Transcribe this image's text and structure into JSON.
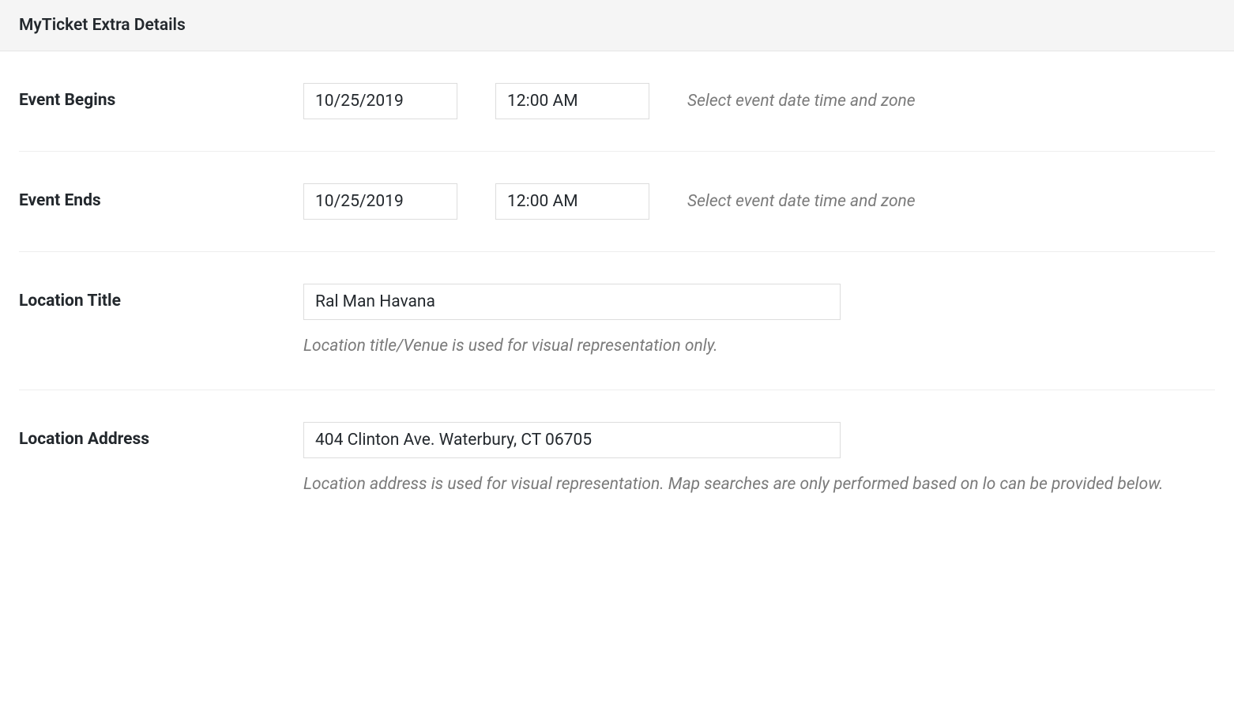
{
  "panel": {
    "title": "MyTicket Extra Details"
  },
  "fields": {
    "event_begins": {
      "label": "Event Begins",
      "date": "10/25/2019",
      "time": "12:00 AM",
      "hint": "Select event date time and zone"
    },
    "event_ends": {
      "label": "Event Ends",
      "date": "10/25/2019",
      "time": "12:00 AM",
      "hint": "Select event date time and zone"
    },
    "location_title": {
      "label": "Location Title",
      "value": "Ral Man Havana",
      "hint": "Location title/Venue is used for visual representation only."
    },
    "location_address": {
      "label": "Location Address",
      "value": "404 Clinton Ave. Waterbury, CT 06705",
      "hint": "Location address is used for visual representation. Map searches are only performed based on lo can be provided below."
    }
  }
}
